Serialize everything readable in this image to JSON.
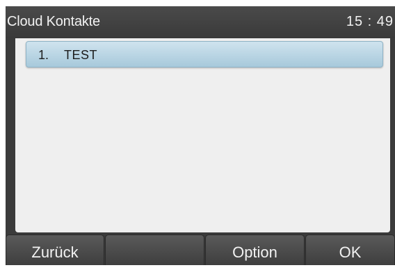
{
  "header": {
    "title": "Cloud Kontakte",
    "clock": "15 : 49"
  },
  "list": {
    "items": [
      {
        "index": "1.",
        "name": "TEST"
      }
    ]
  },
  "softkeys": [
    {
      "label": "Zurück"
    },
    {
      "label": ""
    },
    {
      "label": "Option"
    },
    {
      "label": "OK"
    }
  ]
}
